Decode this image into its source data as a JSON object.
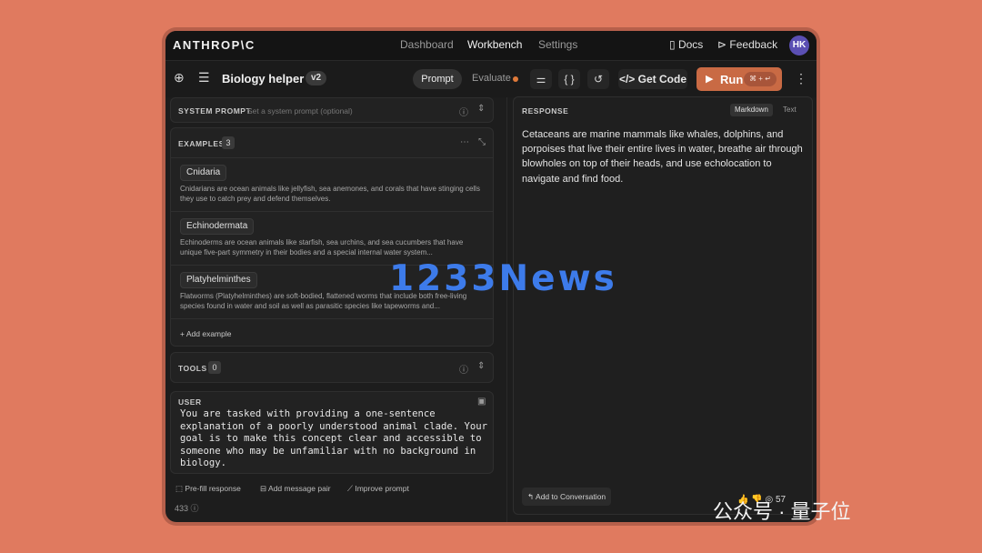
{
  "app": {
    "logo": "ANTHROP\\C",
    "nav": [
      "Dashboard",
      "Workbench",
      "Settings"
    ],
    "nav_active": "Workbench",
    "docs": "Docs",
    "feedback": "Feedback",
    "avatar": "HK"
  },
  "toolbar": {
    "title": "Biology helper",
    "version": "v2",
    "prompt_tab": "Prompt",
    "evaluate_tab": "Evaluate",
    "get_code": "Get Code",
    "run": "Run",
    "run_shortcut": "⌘ + ↵"
  },
  "system_prompt": {
    "label": "SYSTEM PROMPT",
    "placeholder": "Set a system prompt (optional)"
  },
  "examples": {
    "label": "EXAMPLES",
    "count": "3",
    "items": [
      {
        "title": "Cnidaria",
        "desc": "Cnidarians are ocean animals like jellyfish, sea anemones, and corals that have stinging cells they use to catch prey and defend themselves."
      },
      {
        "title": "Echinodermata",
        "desc": "Echinoderms are ocean animals like starfish, sea urchins, and sea cucumbers that have unique five-part symmetry in their bodies and a special internal water system..."
      },
      {
        "title": "Platyhelminthes",
        "desc": "Flatworms (Platyhelminthes) are soft-bodied, flattened worms that include both free-living species found in water and soil as well as parasitic species like tapeworms and..."
      }
    ],
    "add_label": "+ Add example"
  },
  "tools": {
    "label": "TOOLS",
    "count": "0"
  },
  "user": {
    "label": "USER",
    "text": "You are tasked with providing a one-sentence explanation of a poorly understood animal clade. Your goal is to make this concept clear and accessible to someone who may be unfamiliar with no background in biology."
  },
  "bottom": {
    "prefill": "Pre-fill response",
    "add_pair": "Add message pair",
    "improve": "Improve prompt",
    "token_count": "433"
  },
  "response": {
    "label": "RESPONSE",
    "format_markdown": "Markdown",
    "format_text": "Text",
    "text": "Cetaceans are marine mammals like whales, dolphins, and porpoises that live their entire lives in water, breathe air through blowholes on top of their heads, and use echolocation to navigate and find food.",
    "add_to_conversation": "Add to Conversation"
  },
  "watermark": {
    "main": "1233News",
    "right": "公众号 · 量子位",
    "right_count": "57"
  }
}
